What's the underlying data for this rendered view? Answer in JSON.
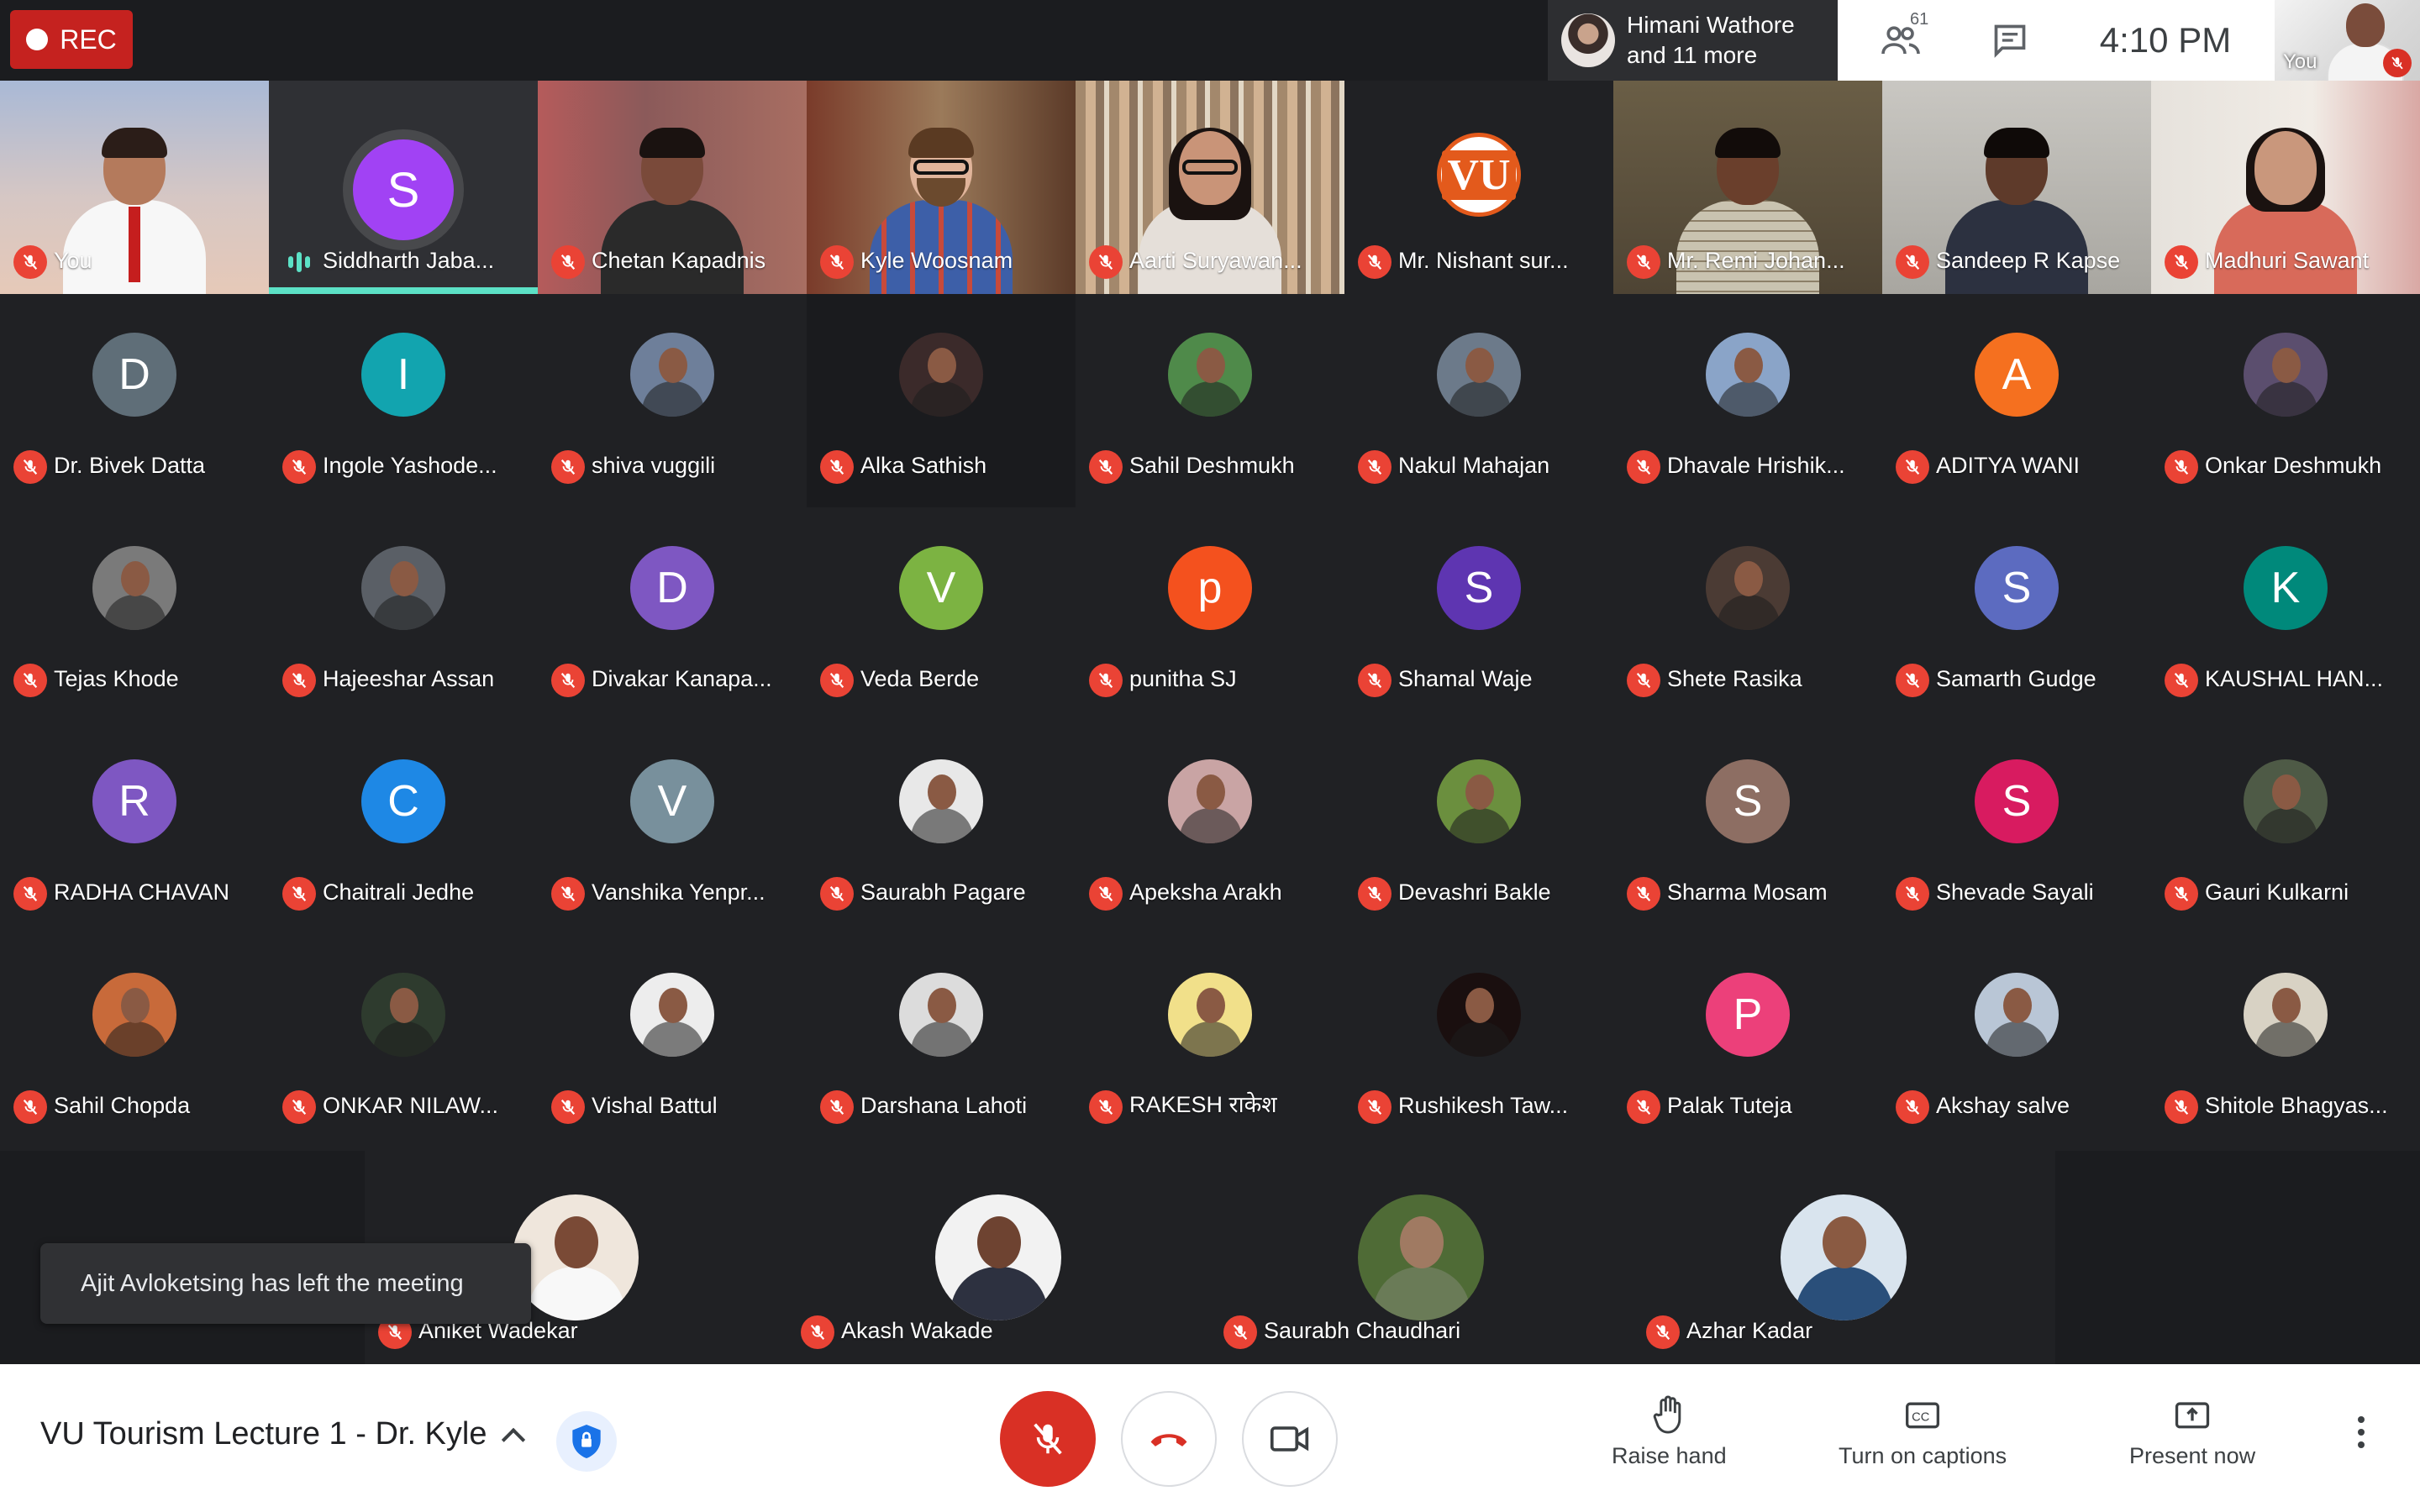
{
  "topbar": {
    "rec_label": "REC",
    "presenters_text_line1": "Himani Wathore",
    "presenters_text_line2": "and 11 more",
    "people_count": "61",
    "time": "4:10 PM",
    "self_label": "You"
  },
  "video_row": [
    {
      "name": "You",
      "muted": true
    },
    {
      "name": "Siddharth Jaba...",
      "muted": false,
      "speaking": true,
      "initial": "S",
      "color": "#a142f4"
    },
    {
      "name": "Chetan Kapadnis",
      "muted": true
    },
    {
      "name": "Kyle Woosnam",
      "muted": true
    },
    {
      "name": "Aarti Suryawan...",
      "muted": true
    },
    {
      "name": "Mr. Nishant sur...",
      "muted": true,
      "logo": "VU"
    },
    {
      "name": "Mr. Remi Johan...",
      "muted": true
    },
    {
      "name": "Sandeep R Kapse",
      "muted": true
    },
    {
      "name": "Madhuri Sawant",
      "muted": true
    }
  ],
  "grid": [
    [
      {
        "name": "Dr. Bivek Datta",
        "initial": "D",
        "color": "#5f6e78"
      },
      {
        "name": "Ingole Yashode...",
        "initial": "I",
        "color": "#12a4af"
      },
      {
        "name": "shiva vuggili",
        "photo": "#6e7f9a"
      },
      {
        "name": "Alka Sathish",
        "photo": "#3b2a2a"
      },
      {
        "name": "Sahil Deshmukh",
        "photo": "#4f8a4a"
      },
      {
        "name": "Nakul Mahajan",
        "photo": "#6c7a8a"
      },
      {
        "name": "Dhavale Hrishik...",
        "photo": "#8aa4c8"
      },
      {
        "name": "ADITYA WANI",
        "initial": "A",
        "color": "#f5701f"
      },
      {
        "name": "Onkar Deshmukh",
        "photo": "#5b4e6e"
      }
    ],
    [
      {
        "name": "Tejas Khode",
        "photo": "#7a7a7a"
      },
      {
        "name": "Hajeeshar Assan",
        "photo": "#5a5f66"
      },
      {
        "name": "Divakar Kanapa...",
        "initial": "D",
        "color": "#7e57c2"
      },
      {
        "name": "Veda Berde",
        "initial": "V",
        "color": "#7cb342"
      },
      {
        "name": "punitha SJ",
        "initial": "p",
        "color": "#f4511e"
      },
      {
        "name": "Shamal Waje",
        "initial": "S",
        "color": "#5e35b1"
      },
      {
        "name": "Shete Rasika",
        "photo": "#4b3b34"
      },
      {
        "name": "Samarth Gudge",
        "initial": "S",
        "color": "#5c6bc0"
      },
      {
        "name": "KAUSHAL HAN...",
        "initial": "K",
        "color": "#00897b"
      }
    ],
    [
      {
        "name": "RADHA CHAVAN",
        "initial": "R",
        "color": "#7e57c2"
      },
      {
        "name": "Chaitrali Jedhe",
        "initial": "C",
        "color": "#1e88e5"
      },
      {
        "name": "Vanshika Yenpr...",
        "initial": "V",
        "color": "#78909c"
      },
      {
        "name": "Saurabh Pagare",
        "photo": "#e8e8e8"
      },
      {
        "name": "Apeksha Arakh",
        "photo": "#c9a4a4"
      },
      {
        "name": "Devashri Bakle",
        "photo": "#6b8f3e"
      },
      {
        "name": "Sharma Mosam",
        "initial": "S",
        "color": "#8d6e63"
      },
      {
        "name": "Shevade Sayali",
        "initial": "S",
        "color": "#d81b60"
      },
      {
        "name": "Gauri Kulkarni",
        "photo": "#4e5a46"
      }
    ],
    [
      {
        "name": "Sahil Chopda",
        "photo": "#c86a3a"
      },
      {
        "name": "ONKAR NILAW...",
        "photo": "#2e3b2e"
      },
      {
        "name": "Vishal Battul",
        "photo": "#ededed"
      },
      {
        "name": "Darshana Lahoti",
        "photo": "#dcdcdc"
      },
      {
        "name": "RAKESH राकेश",
        "photo": "#f1e08a"
      },
      {
        "name": "Rushikesh Taw...",
        "photo": "#1a0f0f"
      },
      {
        "name": "Palak Tuteja",
        "initial": "P",
        "color": "#ec407a"
      },
      {
        "name": "Akshay salve",
        "photo": "#b9c6d6"
      },
      {
        "name": "Shitole Bhagyas...",
        "photo": "#d8d2c4"
      }
    ]
  ],
  "last_row": [
    {
      "name": "Aniket Wadekar",
      "photo": "#efe6dc"
    },
    {
      "name": "Akash Wakade",
      "photo": "#f2f2f2"
    },
    {
      "name": "Saurabh Chaudhari",
      "photo": "#4f6b36"
    },
    {
      "name": "Azhar Kadar",
      "photo": "#d9e4ee"
    }
  ],
  "toast": "Ajit Avloketsing has left the meeting",
  "bottombar": {
    "meeting_title": "VU Tourism Lecture 1 - Dr. Kyle",
    "raise_hand": "Raise hand",
    "captions": "Turn on captions",
    "present": "Present now"
  },
  "colors": {
    "accent": "#1a73e8",
    "danger": "#d93025",
    "speaking": "#5ce1c6"
  }
}
